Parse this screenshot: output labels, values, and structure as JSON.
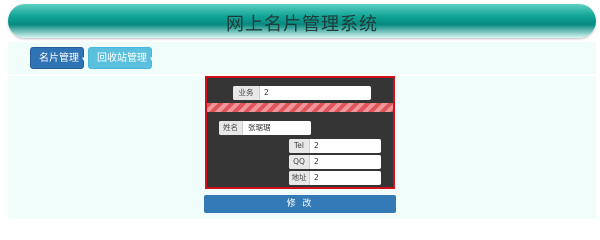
{
  "header": {
    "title": "网上名片管理系统"
  },
  "nav": {
    "card_menu": "名片管理",
    "recycle_menu": "回收站管理",
    "caret": "▾"
  },
  "form": {
    "business": {
      "label": "业务",
      "value": "2"
    },
    "name": {
      "label": "姓名",
      "value": "张琚琚"
    },
    "tel": {
      "label": "Tel",
      "value": "2"
    },
    "qq": {
      "label": "QQ",
      "value": "2"
    },
    "address": {
      "label": "地址",
      "value": "2"
    },
    "submit_label": "修 改"
  },
  "colors": {
    "header_accent": "#12a597",
    "primary_button": "#2f73b5",
    "info_button": "#5bc0de",
    "card_border": "#d0101b",
    "card_background": "#353535"
  }
}
